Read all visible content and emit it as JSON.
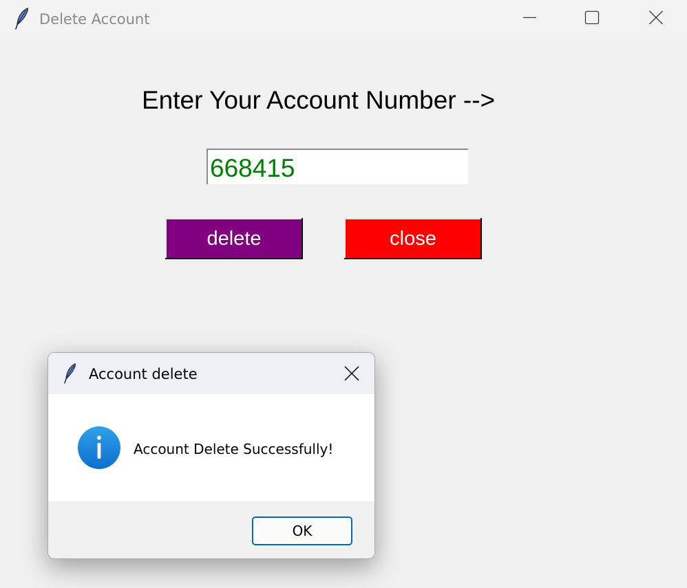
{
  "window": {
    "title": "Delete Account",
    "icon": "feather-icon",
    "controls": {
      "minimize": "minimize-icon",
      "maximize": "maximize-icon",
      "close": "close-icon"
    }
  },
  "form": {
    "prompt_label": "Enter Your Account Number -->",
    "account_number_value": "668415",
    "delete_label": "delete",
    "close_label": "close"
  },
  "dialog": {
    "title": "Account delete",
    "icon": "feather-icon",
    "info_icon": "info-icon",
    "message": "Account Delete Successfully!",
    "ok_label": "OK"
  },
  "colors": {
    "window_bg": "#f0f0f0",
    "titlebar_bg": "#f3f3f3",
    "input_text": "#008000",
    "delete_button_bg": "#800080",
    "close_button_bg": "#ff0000",
    "button_text": "#ffffff",
    "dialog_titlebar_bg": "#eff0f5",
    "dialog_footer_bg": "#f0f0f0",
    "ok_button_border": "#0067c0",
    "info_icon_blue": "#1a84d8"
  }
}
